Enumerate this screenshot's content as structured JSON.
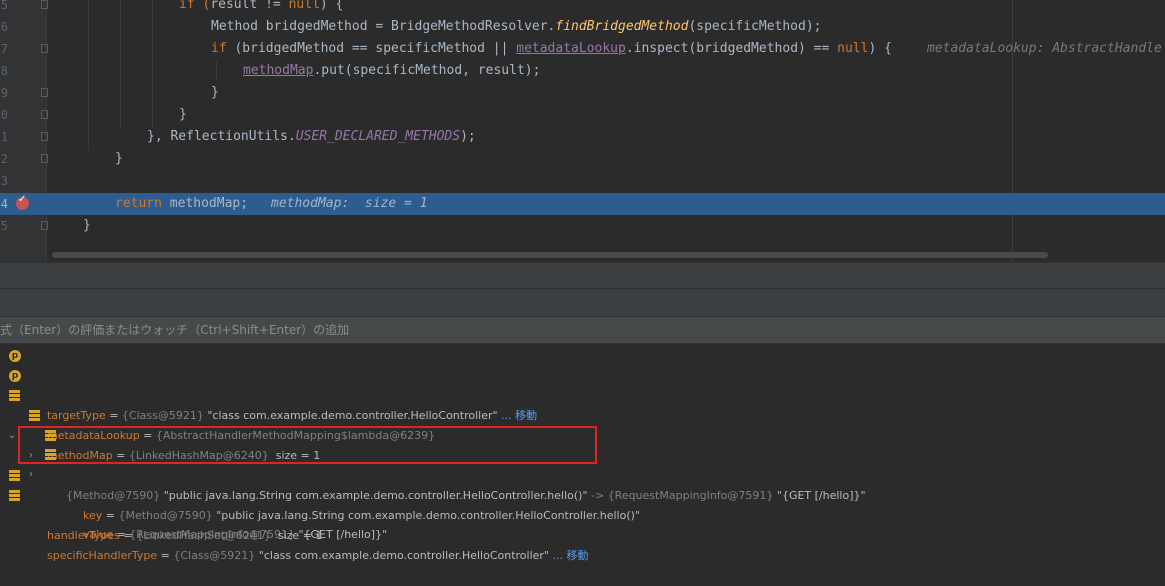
{
  "editor": {
    "line_numbers": [
      "5",
      "6",
      "7",
      "8",
      "9",
      "0",
      "1",
      "2",
      "3",
      "4",
      "5"
    ],
    "lines": [
      [
        {
          "t": "if (",
          "c": "kw"
        },
        {
          "t": "result != ",
          "c": ""
        },
        {
          "t": "null",
          "c": "kw"
        },
        {
          "t": ") {",
          "c": ""
        }
      ],
      [
        {
          "t": "Method bridgedMethod = BridgeMethodResolver.",
          "c": ""
        },
        {
          "t": "findBridgedMethod",
          "c": "fn"
        },
        {
          "t": "(specificMethod);",
          "c": ""
        }
      ],
      [
        {
          "t": "if ",
          "c": "kw"
        },
        {
          "t": "(bridgedMethod == specificMethod || ",
          "c": ""
        },
        {
          "t": "metadataLookup",
          "c": "fld"
        },
        {
          "t": ".inspect(bridgedMethod) == ",
          "c": ""
        },
        {
          "t": "null",
          "c": "kw"
        },
        {
          "t": ") {",
          "c": ""
        }
      ],
      [
        {
          "t": "methodMap",
          "c": "fld"
        },
        {
          "t": ".put(specificMethod, result);",
          "c": ""
        }
      ],
      [
        {
          "t": "}",
          "c": ""
        }
      ],
      [
        {
          "t": "}",
          "c": ""
        }
      ],
      [
        {
          "t": "}, ReflectionUtils.",
          "c": ""
        },
        {
          "t": "USER_DECLARED_METHODS",
          "c": "cst"
        },
        {
          "t": ");",
          "c": ""
        }
      ],
      [
        {
          "t": "}",
          "c": ""
        }
      ],
      [],
      [
        {
          "t": "return ",
          "c": "kw"
        },
        {
          "t": "methodMap;",
          "c": ""
        }
      ],
      [
        {
          "t": "}",
          "c": ""
        }
      ]
    ],
    "hint_line8": "metadataLookup: AbstractHandle",
    "hint_line14": "methodMap:  size = 1"
  },
  "eval_bar": {
    "text": "式（Enter）の評価またはウォッチ（Ctrl+Shift+Enter）の追加"
  },
  "variables": {
    "target_type": {
      "name": "targetType",
      "type": "{Class@5921}",
      "value": "\"class com.example.demo.controller.HelloController\"",
      "link": "... 移動"
    },
    "metadata_lookup": {
      "name": "metadataLookup",
      "type": "{AbstractHandlerMethodMapping$lambda@6239}"
    },
    "method_map": {
      "name": "methodMap",
      "type": "{LinkedHashMap@6240}",
      "size": "size = 1"
    },
    "entry": {
      "type": "{Method@7590}",
      "value": "\"public java.lang.String com.example.demo.controller.HelloController.hello()\"",
      "arrow": "->",
      "type2": "{RequestMappingInfo@7591}",
      "value2": "\"{GET [/hello]}\""
    },
    "key": {
      "name": "key",
      "type": "{Method@7590}",
      "value": "\"public java.lang.String com.example.demo.controller.HelloController.hello()\""
    },
    "value": {
      "name": "value",
      "type": "{RequestMappingInfo@7591}",
      "value": "\"{GET [/hello]}\""
    },
    "handler_types": {
      "name": "handlerTypes",
      "type": "{LinkedHashSet@6241}",
      "size": "size = 1"
    },
    "specific_handler_type": {
      "name": "specificHandlerType",
      "type": "{Class@5921}",
      "value": "\"class com.example.demo.controller.HelloController\"",
      "link": "... 移動"
    }
  },
  "colors": {
    "editor_bg": "#2b2b2b",
    "highlight": "#2d5c8f",
    "keyword": "#cc7832",
    "field": "#9876aa",
    "method": "#ffc66d",
    "red_box": "#e02424"
  }
}
